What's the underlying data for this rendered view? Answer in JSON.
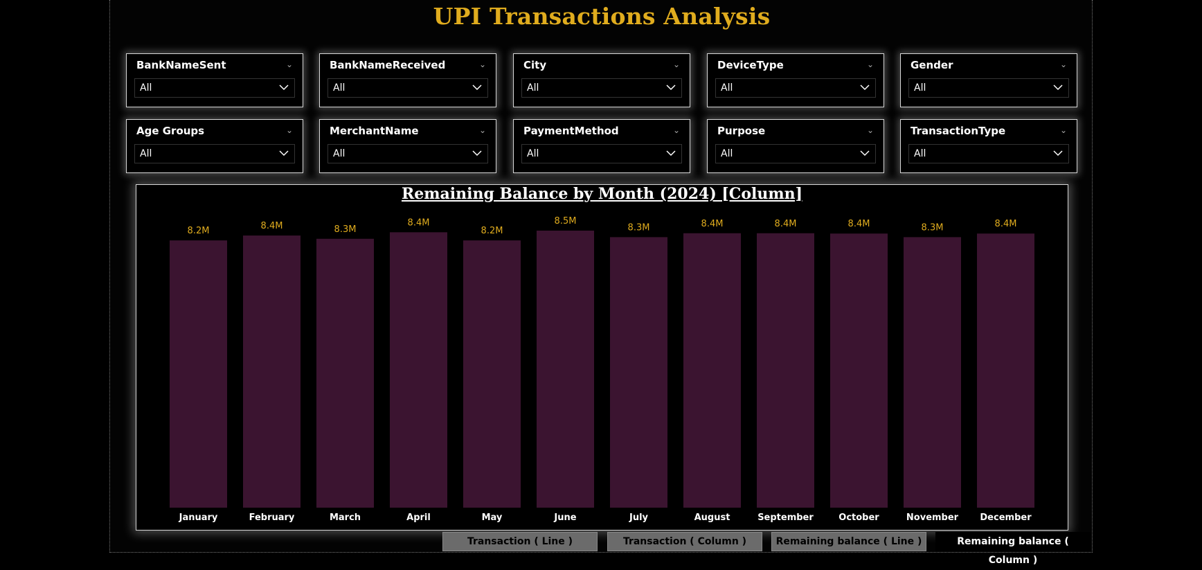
{
  "title": "UPI Transactions Analysis",
  "slicers": [
    {
      "label": "BankNameSent",
      "value": "All"
    },
    {
      "label": "BankNameReceived",
      "value": "All"
    },
    {
      "label": "City",
      "value": "All"
    },
    {
      "label": "DeviceType",
      "value": "All"
    },
    {
      "label": "Gender",
      "value": "All"
    },
    {
      "label": "Age Groups",
      "value": "All"
    },
    {
      "label": "MerchantName",
      "value": "All"
    },
    {
      "label": "PaymentMethod",
      "value": "All"
    },
    {
      "label": "Purpose",
      "value": "All"
    },
    {
      "label": "TransactionType",
      "value": "All"
    }
  ],
  "chart_data": {
    "type": "bar",
    "title": "Remaining Balance by Month (2024) [Column]",
    "categories": [
      "January",
      "February",
      "March",
      "April",
      "May",
      "June",
      "July",
      "August",
      "September",
      "October",
      "November",
      "December"
    ],
    "values": [
      8200000,
      8350000,
      8250000,
      8450000,
      8200000,
      8500000,
      8300000,
      8420000,
      8420000,
      8410000,
      8300000,
      8410000
    ],
    "data_labels": [
      "8.2M",
      "8.4M",
      "8.3M",
      "8.4M",
      "8.2M",
      "8.5M",
      "8.3M",
      "8.4M",
      "8.4M",
      "8.4M",
      "8.3M",
      "8.4M"
    ],
    "ylim": [
      0,
      8500000
    ],
    "bar_color": "#3b1430",
    "label_color": "#e0ac1e",
    "grid": false,
    "y_axis_visible": false
  },
  "nav_buttons": [
    {
      "label": "Transaction ( Line )",
      "active": false
    },
    {
      "label": "Transaction ( Column )",
      "active": false
    },
    {
      "label": "Remaining balance ( Line )",
      "active": false
    },
    {
      "label": "Remaining balance ( Column )",
      "active": true
    }
  ],
  "colors": {
    "title": "#e0ac1e",
    "background": "#000000",
    "bar": "#3b1430",
    "nav_inactive": "#6b6b6b"
  }
}
